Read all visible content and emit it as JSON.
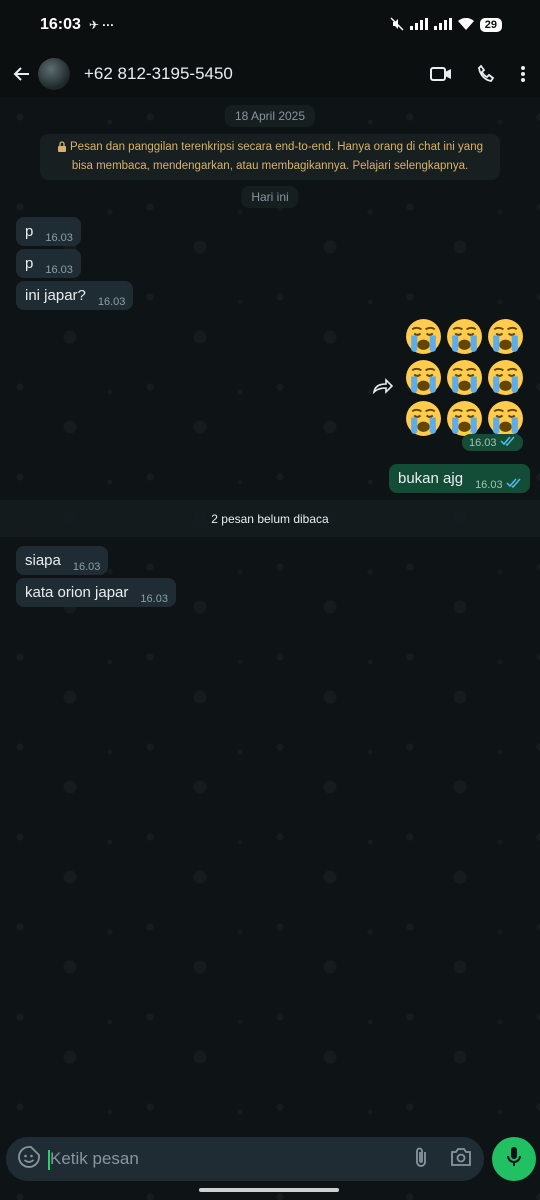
{
  "status_bar": {
    "time": "16:03",
    "extra": "✈ ···",
    "battery": "29"
  },
  "header": {
    "contact": "+62 812-3195-5450"
  },
  "chat": {
    "date_label": "18 April 2025",
    "encryption_notice": "Pesan dan panggilan terenkripsi secara end-to-end. Hanya orang di chat ini yang bisa membaca, mendengarkan, atau membagikannya. Pelajari selengkapnya.",
    "today_label": "Hari ini",
    "unread_label": "2 pesan belum dibaca",
    "messages": [
      {
        "text": "p",
        "time": "16.03"
      },
      {
        "text": "p",
        "time": "16.03"
      },
      {
        "text": "ini japar?",
        "time": "16.03"
      },
      {
        "text": "",
        "time": "16.03"
      },
      {
        "text": "bukan ajg",
        "time": "16.03"
      },
      {
        "text": "siapa",
        "time": "16.03"
      },
      {
        "text": "kata orion japar",
        "time": "16.03"
      }
    ],
    "emoji_name": "loudly-crying-face"
  },
  "composer": {
    "placeholder": "Ketik pesan"
  },
  "colors": {
    "incoming_bubble": "#1f2c33",
    "outgoing_bubble": "#134d37",
    "accent": "#21c063",
    "read_tick": "#53bdeb"
  }
}
